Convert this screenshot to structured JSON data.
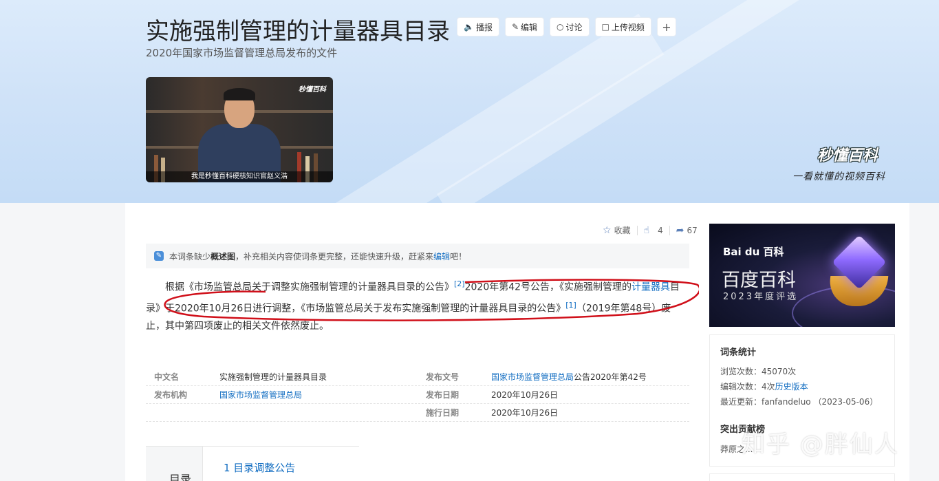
{
  "header": {
    "title": "实施强制管理的计量器具目录",
    "subtitle": "2020年国家市场监督管理总局发布的文件",
    "tools": [
      {
        "label": "播报",
        "icon": "speaker-icon"
      },
      {
        "label": "编辑",
        "icon": "pencil-icon"
      },
      {
        "label": "讨论",
        "icon": "chat-bubble-icon"
      },
      {
        "label": "上传视频",
        "icon": "video-camera-icon"
      }
    ],
    "plus_symbol": "+",
    "video_caption": "我是秒懂百科硬核知识官赵义浩",
    "video_logo": "秒懂百科",
    "brand_logo": "秒懂百科",
    "brand_slogan": "一看就懂的视频百科"
  },
  "actions": {
    "collect_label": "收藏",
    "like_count": "4",
    "share_count": "67"
  },
  "notice": {
    "prefix": "本词条缺少",
    "bold": "概述图",
    "middle": "，补充相关内容使词条更完整，还能快速升级，赶紧来",
    "link": "编辑",
    "suffix": "吧！"
  },
  "paragraph": {
    "p1": "根据《市场监管总局关于调整实施强制管理的计量器具目录的公告》",
    "ref1": "[2]",
    "p2": "2020年第42号公告，《实施强制管理的",
    "link1": "计量器具",
    "p3": "目录》于2020年10月26日进行调整，《市场监管总局关于发布实施强制管理的计量器具目录的公告》",
    "ref2": "[1]",
    "p4": "（2019年第48号）废止，其中第四项废止的相关文件依然废止。"
  },
  "info": {
    "rows": [
      {
        "l1": "中文名",
        "v1": "实施强制管理的计量器具目录",
        "l2": "发布文号",
        "v2_link": "国家市场监督管理总局",
        "v2_rest": "公告2020年第42号"
      },
      {
        "l1": "发布机构",
        "v1_link": "国家市场监督管理总局",
        "l2": "发布日期",
        "v2": "2020年10月26日"
      },
      {
        "l2": "施行日期",
        "v2": "2020年10月26日"
      }
    ]
  },
  "toc": {
    "title": "目录",
    "item1": "1  目录调整公告"
  },
  "ad": {
    "logo": "Bai du 百科",
    "title": "百度百科",
    "sub": "2023年度评选"
  },
  "stats": {
    "heading": "词条统计",
    "views": "浏览次数：45070次",
    "edits_prefix": "编辑次数：4次",
    "edits_link": "历史版本",
    "updated": "最近更新：fanfandeluo （2023-05-06）",
    "contrib_heading": "突出贡献榜",
    "contrib_user": "莽原之..."
  },
  "watermark": "知乎 @胖仙人",
  "colors": {
    "link": "#136ec2",
    "annotation": "#d0101a"
  }
}
